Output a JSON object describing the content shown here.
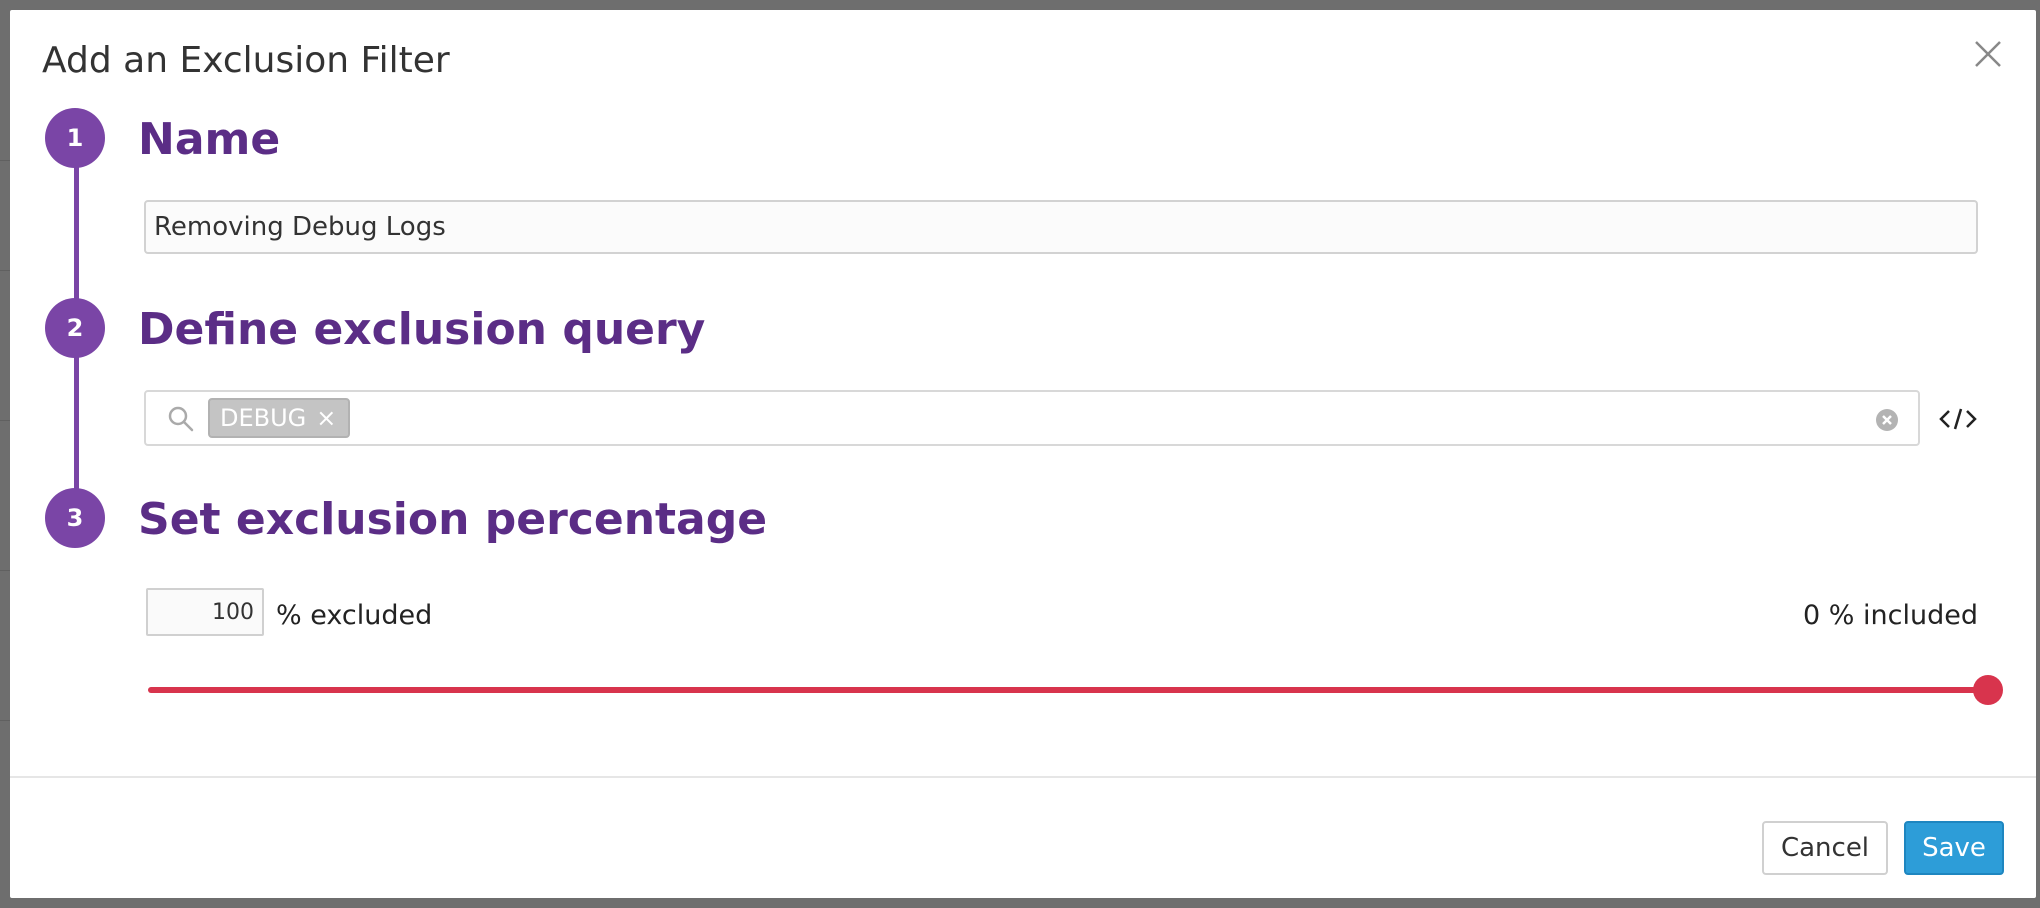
{
  "modal": {
    "title": "Add an Exclusion Filter"
  },
  "steps": [
    {
      "number": "1",
      "title": "Name"
    },
    {
      "number": "2",
      "title": "Define exclusion query"
    },
    {
      "number": "3",
      "title": "Set exclusion percentage"
    }
  ],
  "name_field": {
    "value": "Removing Debug Logs"
  },
  "query": {
    "tags": [
      {
        "label": "DEBUG",
        "remove": "×"
      }
    ],
    "toggle_icon": "code-icon"
  },
  "exclusion": {
    "percent_value": "100",
    "excluded_label": "% excluded",
    "included_label": "0 % included",
    "slider_value_percent": 100
  },
  "buttons": {
    "cancel": "Cancel",
    "save": "Save"
  },
  "colors": {
    "step_accent": "#7a45a6",
    "step_title": "#5b2d86",
    "slider": "#d8344d",
    "primary_button": "#2d9dd8"
  }
}
